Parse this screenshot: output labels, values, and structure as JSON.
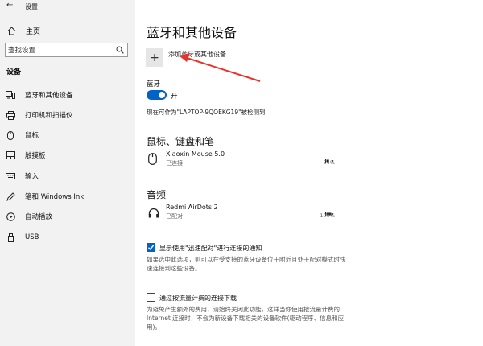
{
  "window": {
    "title": "设置"
  },
  "sidebar": {
    "home_label": "主页",
    "search_placeholder": "查找设置",
    "section_label": "设备",
    "items": [
      {
        "label": "蓝牙和其他设备",
        "icon": "bluetooth-devices-icon"
      },
      {
        "label": "打印机和扫描仪",
        "icon": "printer-icon"
      },
      {
        "label": "鼠标",
        "icon": "mouse-icon"
      },
      {
        "label": "触摸板",
        "icon": "touchpad-icon"
      },
      {
        "label": "输入",
        "icon": "keyboard-icon"
      },
      {
        "label": "笔和 Windows Ink",
        "icon": "pen-icon"
      },
      {
        "label": "自动播放",
        "icon": "autoplay-icon"
      },
      {
        "label": "USB",
        "icon": "usb-icon"
      }
    ]
  },
  "main": {
    "title": "蓝牙和其他设备",
    "add_device_label": "添加蓝牙或其他设备",
    "bluetooth_label": "蓝牙",
    "bluetooth_state": "开",
    "bluetooth_on": true,
    "discoverable_text": "现在可作为\"LAPTOP-9QOEKG19\"被检测到",
    "sections": [
      {
        "title": "鼠标、键盘和笔",
        "devices": [
          {
            "name": "Xiaoxin Mouse 5.0",
            "status": "已连接",
            "battery": "54%",
            "battery_fraction": 0.54,
            "icon": "mouse-icon"
          }
        ]
      },
      {
        "title": "音频",
        "devices": [
          {
            "name": "Redmi AirDots 2",
            "status": "已配对",
            "battery": "100%",
            "battery_fraction": 1.0,
            "icon": "headphones-icon"
          }
        ]
      }
    ],
    "swift_pair": {
      "checked": true,
      "label": "显示使用\"迅速配对\"进行连接的通知",
      "description": "如果选中此选项，则可以在受支持的蓝牙设备位于附近且处于配对模式时快速连接到这些设备。"
    },
    "metered": {
      "checked": false,
      "label": "通过按流量计费的连接下载",
      "description": "为避免产生额外的费用，请始终关闭此功能，这样当你使用按流量计费的 Internet 连接时，不会为新设备下载相关的设备软件(驱动程序、信息和应用)。"
    }
  },
  "colors": {
    "accent": "#0063c5",
    "annotation": "#e8332a",
    "sidebar_bg": "#f2f2f2"
  }
}
